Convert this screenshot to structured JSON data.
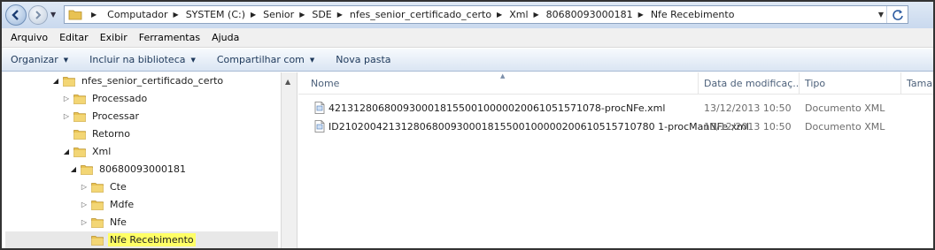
{
  "breadcrumb": [
    "Computador",
    "SYSTEM (C:)",
    "Senior",
    "SDE",
    "nfes_senior_certificado_certo",
    "Xml",
    "80680093000181",
    "Nfe Recebimento"
  ],
  "menu": [
    "Arquivo",
    "Editar",
    "Exibir",
    "Ferramentas",
    "Ajuda"
  ],
  "toolbar": {
    "organize": "Organizar",
    "include": "Incluir na biblioteca",
    "share": "Compartilhar com",
    "new_folder": "Nova pasta"
  },
  "tree": [
    {
      "label": "nfes_senior_certificado_certo",
      "expander": "expanded",
      "depth": 0
    },
    {
      "label": "Processado",
      "expander": "collapsed",
      "depth": 1
    },
    {
      "label": "Processar",
      "expander": "collapsed",
      "depth": 1
    },
    {
      "label": "Retorno",
      "expander": "none",
      "depth": 1
    },
    {
      "label": "Xml",
      "expander": "expanded",
      "depth": 1
    },
    {
      "label": "80680093000181",
      "expander": "expanded",
      "depth": 2
    },
    {
      "label": "Cte",
      "expander": "collapsed",
      "depth": 3
    },
    {
      "label": "Mdfe",
      "expander": "collapsed",
      "depth": 3
    },
    {
      "label": "Nfe",
      "expander": "collapsed",
      "depth": 3
    },
    {
      "label": "Nfe Recebimento",
      "expander": "none",
      "depth": 3,
      "selected": true
    }
  ],
  "columns": {
    "name": "Nome",
    "date": "Data de modificaç...",
    "type": "Tipo",
    "size": "Taman"
  },
  "files": [
    {
      "name": "42131280680093000181550010000020061051571078-procNFe.xml",
      "date": "13/12/2013 10:50",
      "type": "Documento XML"
    },
    {
      "name": "ID210200421312806800930001815500100000200610515710780 1-procManNFe.xml",
      "date": "13/12/2013 10:50",
      "type": "Documento XML"
    }
  ],
  "colors": {
    "highlight": "#ffff66",
    "header_text": "#4c607a",
    "toolbar_text": "#1e395b"
  },
  "icons": {
    "back": "back-arrow-icon",
    "forward": "forward-arrow-icon",
    "refresh": "refresh-icon",
    "folder": "folder-icon",
    "xml": "xml-document-icon"
  }
}
